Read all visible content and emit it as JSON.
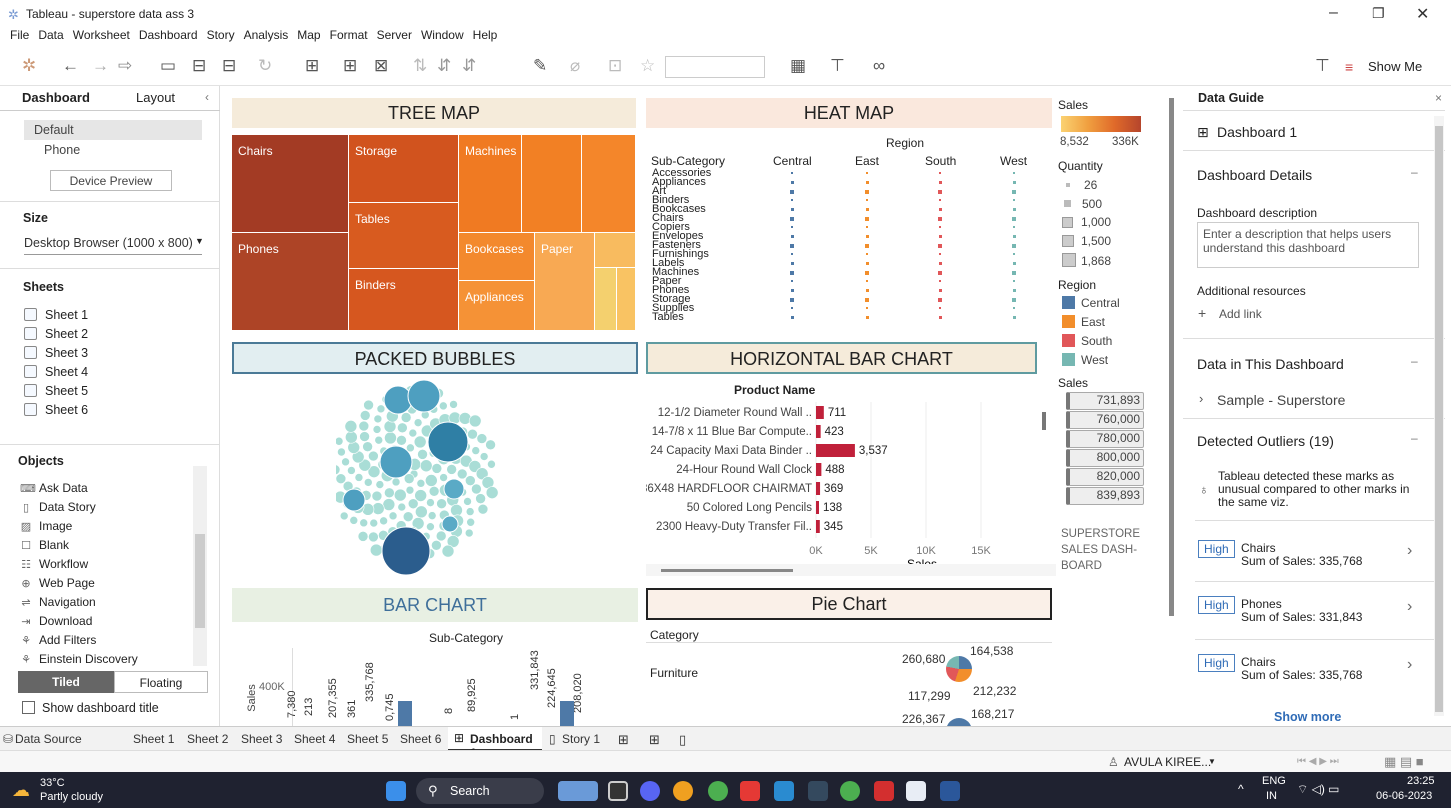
{
  "window": {
    "title": "Tableau - superstore data ass 3"
  },
  "menu": [
    "File",
    "Data",
    "Worksheet",
    "Dashboard",
    "Story",
    "Analysis",
    "Map",
    "Format",
    "Server",
    "Window",
    "Help"
  ],
  "toolbar": {
    "show_me": "Show Me"
  },
  "left": {
    "tab_dashboard": "Dashboard",
    "tab_layout": "Layout",
    "device_default": "Default",
    "device_phone": "Phone",
    "device_preview": "Device Preview",
    "size_h": "Size",
    "size_value": "Desktop Browser (1000 x 800)",
    "sheets_h": "Sheets",
    "sheets": [
      "Sheet 1",
      "Sheet 2",
      "Sheet 3",
      "Sheet 4",
      "Sheet 5",
      "Sheet 6"
    ],
    "objects_h": "Objects",
    "objects": [
      "Ask Data",
      "Data Story",
      "Image",
      "Blank",
      "Workflow",
      "Web Page",
      "Navigation",
      "Download",
      "Add Filters",
      "Einstein Discovery"
    ],
    "tiled": "Tiled",
    "floating": "Floating",
    "show_title": "Show dashboard title"
  },
  "zones": {
    "treemap": "TREE MAP",
    "heatmap": "HEAT MAP",
    "bubbles": "PACKED BUBBLES",
    "hbar": "HORIZONTAL BAR CHART",
    "bar": "BAR CHART",
    "pie": "Pie Chart"
  },
  "treemap": {
    "labels": [
      "Chairs",
      "Storage",
      "Machines",
      "Tables",
      "Phones",
      "Bookcases",
      "Binders",
      "Appliances",
      "Paper"
    ]
  },
  "heatmap": {
    "region_h": "Region",
    "subcat_h": "Sub-Category",
    "regions": [
      "Central",
      "East",
      "South",
      "West"
    ],
    "subcats": [
      "Accessories",
      "Appliances",
      "Art",
      "Binders",
      "Bookcases",
      "Chairs",
      "Copiers",
      "Envelopes",
      "Fasteners",
      "Furnishings",
      "Labels",
      "Machines",
      "Paper",
      "Phones",
      "Storage",
      "Supplies",
      "Tables"
    ]
  },
  "legend": {
    "sales_h": "Sales",
    "sales_min": "8,532",
    "sales_max": "336K",
    "qty_h": "Quantity",
    "qty": [
      "26",
      "500",
      "1,000",
      "1,500",
      "1,868"
    ],
    "region_h": "Region",
    "regions": [
      "Central",
      "East",
      "South",
      "West"
    ],
    "sales2_h": "Sales",
    "sales_vals": [
      "731,893",
      "760,000",
      "780,000",
      "800,000",
      "820,000",
      "839,893"
    ],
    "footer": "SUPERSTORE SALES DASH- BOARD"
  },
  "hbar_chart": {
    "header": "Product Name",
    "xlabel": "Sales",
    "ticks": [
      "0K",
      "5K",
      "10K",
      "15K"
    ]
  },
  "bar_chart": {
    "header": "Sub-Category",
    "ylabel": "Sales",
    "ytick": "400K",
    "labels": [
      "7,380",
      "213",
      "207,355",
      "361",
      "335,768",
      "0,745",
      "8",
      "89,925",
      "1",
      "331,843",
      "224,645",
      "208,020"
    ]
  },
  "pie_chart": {
    "category_h": "Category",
    "furniture": "Furniture",
    "labels": [
      "260,680",
      "164,538",
      "117,299",
      "212,232",
      "226,367",
      "168,217"
    ]
  },
  "chart_data": [
    {
      "type": "bar",
      "title": "HORIZONTAL BAR CHART",
      "categories": [
        "12-1/2 Diameter Round Wall ..",
        "14-7/8 x 11 Blue Bar Compute..",
        "24 Capacity Maxi Data Binder ..",
        "24-Hour Round Wall Clock",
        "36X48 HARDFLOOR CHAIRMAT",
        "50 Colored Long Pencils",
        "2300 Heavy-Duty Transfer Fil.."
      ],
      "values": [
        711,
        423,
        3537,
        488,
        369,
        138,
        345
      ],
      "xlabel": "Sales",
      "ylabel": "Product Name",
      "xlim": [
        0,
        15000
      ]
    }
  ],
  "right": {
    "title": "Data Guide",
    "dashboard": "Dashboard 1",
    "details_h": "Dashboard Details",
    "desc_h": "Dashboard description",
    "desc_ph": "Enter a description that helps users understand this dashboard",
    "resources_h": "Additional resources",
    "add_link": "Add link",
    "data_h": "Data in This Dashboard",
    "source": "Sample - Superstore",
    "outliers_h": "Detected Outliers (19)",
    "outliers_text": "Tableau detected these marks as unusual compared to other marks in the same viz.",
    "outliers": [
      {
        "badge": "High",
        "name": "Chairs",
        "value": "Sum of Sales: 335,768"
      },
      {
        "badge": "High",
        "name": "Phones",
        "value": "Sum of Sales: 331,843"
      },
      {
        "badge": "High",
        "name": "Chairs",
        "value": "Sum of Sales: 335,768"
      }
    ],
    "show_more": "Show more"
  },
  "tabs": {
    "datasource": "Data Source",
    "sheets": [
      "Sheet 1",
      "Sheet 2",
      "Sheet 3",
      "Sheet 4",
      "Sheet 5",
      "Sheet 6"
    ],
    "dashboard": "Dashboard 1",
    "story": "Story 1"
  },
  "status": {
    "user": "AVULA KIREE..."
  },
  "taskbar": {
    "temp": "33°C",
    "weather": "Partly cloudy",
    "search": "Search",
    "lang": "ENG",
    "lang2": "IN",
    "time": "23:25",
    "date": "06-06-2023"
  }
}
